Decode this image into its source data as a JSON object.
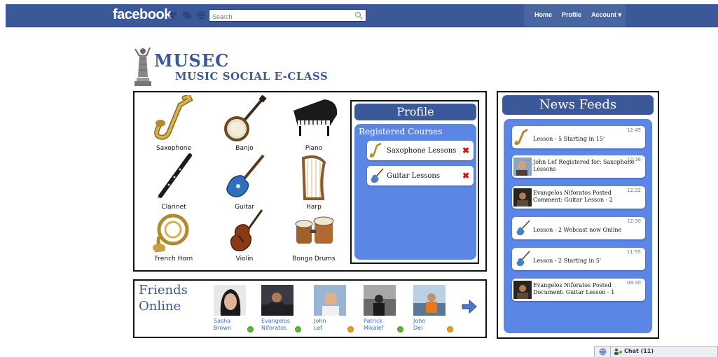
{
  "facebook_bar": {
    "logo": "facebook",
    "search_placeholder": "Search",
    "nav": [
      "Home",
      "Profile",
      "Account ▾"
    ],
    "brand_color": "#3b5998"
  },
  "app_logo": {
    "title": "MUSEC",
    "subtitle": "MUSIC SOCIAL E-CLASS"
  },
  "instruments": [
    {
      "label": "Saxophone",
      "icon": "saxophone-icon"
    },
    {
      "label": "Banjo",
      "icon": "banjo-icon"
    },
    {
      "label": "Piano",
      "icon": "piano-icon"
    },
    {
      "label": "Clarinet",
      "icon": "clarinet-icon"
    },
    {
      "label": "Guitar",
      "icon": "guitar-icon"
    },
    {
      "label": "Harp",
      "icon": "harp-icon"
    },
    {
      "label": "French Horn",
      "icon": "french-horn-icon"
    },
    {
      "label": "Violin",
      "icon": "violin-icon"
    },
    {
      "label": "Bongo Drums",
      "icon": "bongo-drums-icon"
    }
  ],
  "profile": {
    "title": "Profile",
    "registered_title": "Registered Courses",
    "courses": [
      {
        "label": "Saxophone Lessons",
        "icon": "saxophone-icon"
      },
      {
        "label": "Guitar Lessons",
        "icon": "guitar-icon"
      }
    ],
    "panel_color": "#5c86e6"
  },
  "news": {
    "title": "News Feeds",
    "items": [
      {
        "time": "12:45",
        "text": "Lesson - 5 Starting in 15'",
        "icon": "saxophone-icon"
      },
      {
        "time": "12:36",
        "text": "John Lef Registered for: Saxophone Lessons",
        "icon": "avatar"
      },
      {
        "time": "12:32",
        "text": "Evangelos Niforatos Posted Comment: Guitar Lesson - 2",
        "icon": "avatar"
      },
      {
        "time": "12:30",
        "text": "Lesson - 2 Webcast now Online",
        "icon": "guitar-icon"
      },
      {
        "time": "11:55",
        "text": "Lesson - 2 Starting in 5'",
        "icon": "guitar-icon"
      },
      {
        "time": "09:30",
        "text": "Evangelos Niforatos Posted Document: Guitar Lesson - 1",
        "icon": "avatar"
      }
    ]
  },
  "friends": {
    "title_line1": "Friends",
    "title_line2": "Online",
    "list": [
      {
        "first": "Sasha",
        "last": "Brown",
        "status": "online",
        "status_color": "#5cb82c"
      },
      {
        "first": "Evangelos",
        "last": "Niforatos",
        "status": "online",
        "status_color": "#5cb82c"
      },
      {
        "first": "John",
        "last": "Lef",
        "status": "away",
        "status_color": "#f09a1c"
      },
      {
        "first": "Patrick",
        "last": "Mikalef",
        "status": "online",
        "status_color": "#5cb82c"
      },
      {
        "first": "John",
        "last": "Del",
        "status": "away",
        "status_color": "#f09a1c"
      }
    ]
  },
  "chat": {
    "label": "Chat (11)"
  }
}
